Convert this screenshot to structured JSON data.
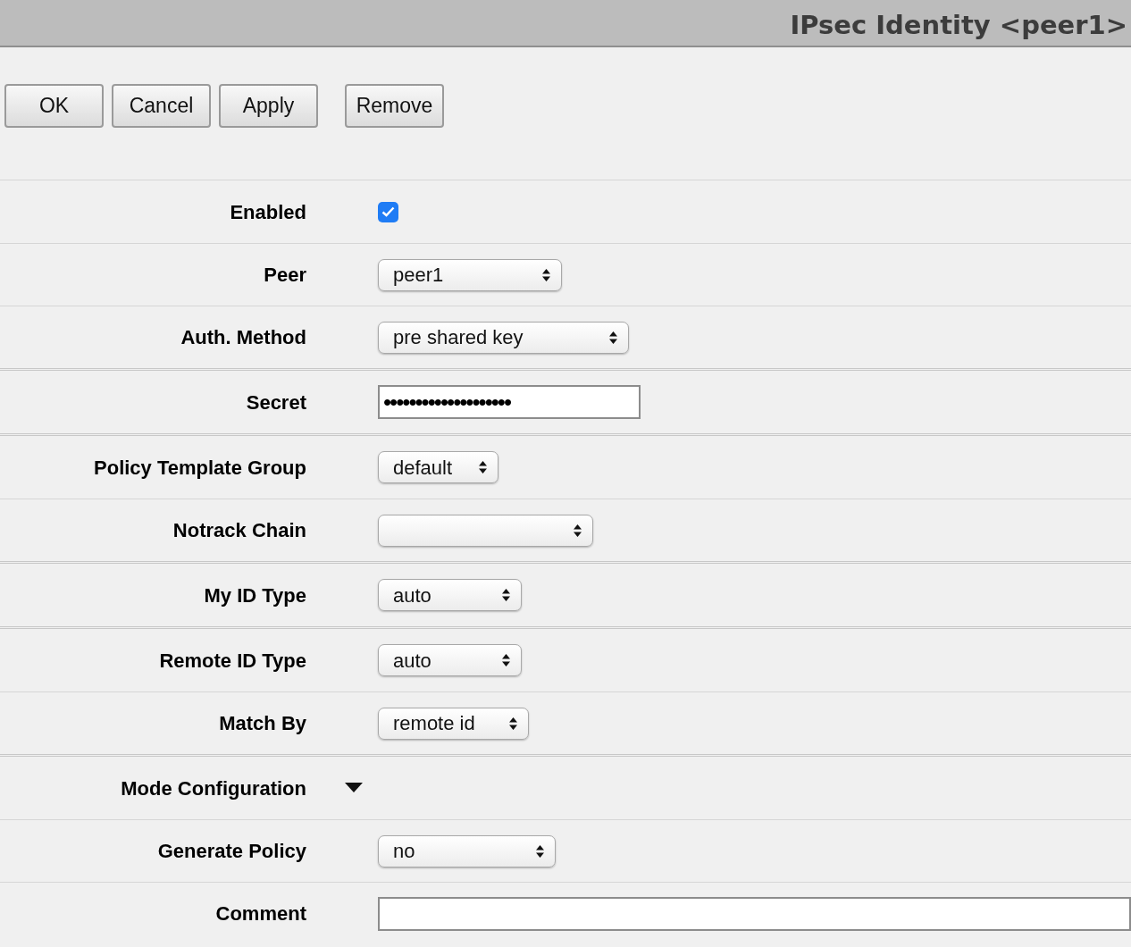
{
  "window": {
    "title": "IPsec Identity <peer1>"
  },
  "buttons": [
    {
      "label": "OK"
    },
    {
      "label": "Cancel"
    },
    {
      "label": "Apply"
    },
    {
      "label": "Remove"
    }
  ],
  "sections": [
    [
      {
        "label": "Enabled",
        "kind": "checkbox",
        "checked": true
      },
      {
        "label": "Peer",
        "kind": "select",
        "value": "peer1"
      },
      {
        "label": "Auth. Method",
        "kind": "select",
        "value": "pre shared key"
      }
    ],
    [
      {
        "label": "Secret",
        "kind": "password",
        "value": "••••••••••••••••••••"
      }
    ],
    [
      {
        "label": "Policy Template Group",
        "kind": "select",
        "value": "default"
      },
      {
        "label": "Notrack Chain",
        "kind": "select"
      }
    ],
    [
      {
        "label": "My ID Type",
        "kind": "select",
        "value": "auto"
      }
    ],
    [
      {
        "label": "Remote ID Type",
        "kind": "select",
        "value": "auto"
      },
      {
        "label": "Match By",
        "kind": "select",
        "value": "remote id"
      }
    ],
    [
      {
        "label": "Mode Configuration",
        "kind": "expander",
        "expanded": true
      },
      {
        "label": "Generate Policy",
        "kind": "select",
        "value": "no"
      },
      {
        "label": "Comment",
        "kind": "textarea"
      }
    ]
  ]
}
